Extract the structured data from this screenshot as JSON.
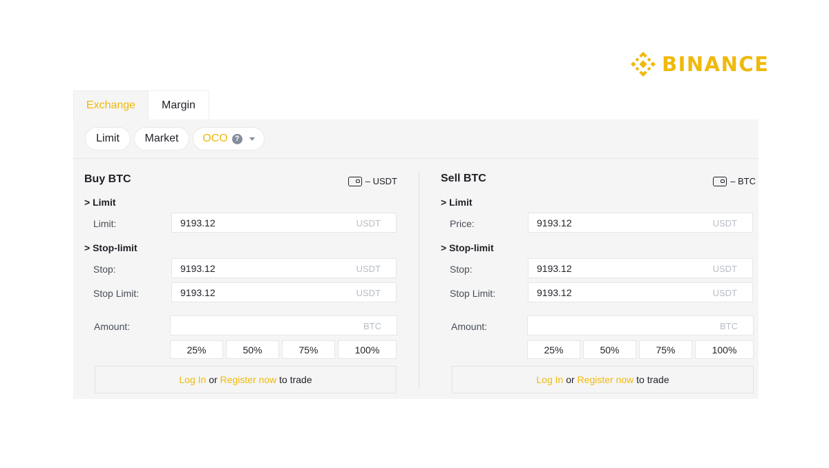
{
  "brand": {
    "name": "BINANCE",
    "color": "#f0b90b",
    "logo_icon": "binance-diamond-icon"
  },
  "tabs": [
    {
      "label": "Exchange",
      "active": true
    },
    {
      "label": "Margin",
      "active": false
    }
  ],
  "order_types": [
    {
      "label": "Limit"
    },
    {
      "label": "Market"
    },
    {
      "label": "OCO",
      "icon": "help-icon",
      "help_glyph": "?",
      "selected": true
    }
  ],
  "buy": {
    "title": "Buy BTC",
    "balance_text": "– USDT",
    "limit_section": "> Limit",
    "limit_label": "Limit:",
    "limit_value": "9193.12",
    "limit_unit": "USDT",
    "stop_section": "> Stop-limit",
    "stop_label": "Stop:",
    "stop_value": "9193.12",
    "stop_unit": "USDT",
    "stop_limit_label": "Stop Limit:",
    "stop_limit_value": "9193.12",
    "stop_limit_unit": "USDT",
    "amount_label": "Amount:",
    "amount_value": "",
    "amount_unit": "BTC",
    "percentages": [
      "25%",
      "50%",
      "75%",
      "100%"
    ],
    "login": "Log In",
    "or": "or",
    "register": "Register now",
    "to_trade": "to trade"
  },
  "sell": {
    "title": "Sell BTC",
    "balance_text": "– BTC",
    "limit_section": "> Limit",
    "limit_label": "Price:",
    "limit_value": "9193.12",
    "limit_unit": "USDT",
    "stop_section": "> Stop-limit",
    "stop_label": "Stop:",
    "stop_value": "9193.12",
    "stop_unit": "USDT",
    "stop_limit_label": "Stop Limit:",
    "stop_limit_value": "9193.12",
    "stop_limit_unit": "USDT",
    "amount_label": "Amount:",
    "amount_value": "",
    "amount_unit": "BTC",
    "percentages": [
      "25%",
      "50%",
      "75%",
      "100%"
    ],
    "login": "Log In",
    "or": "or",
    "register": "Register now",
    "to_trade": "to trade"
  }
}
